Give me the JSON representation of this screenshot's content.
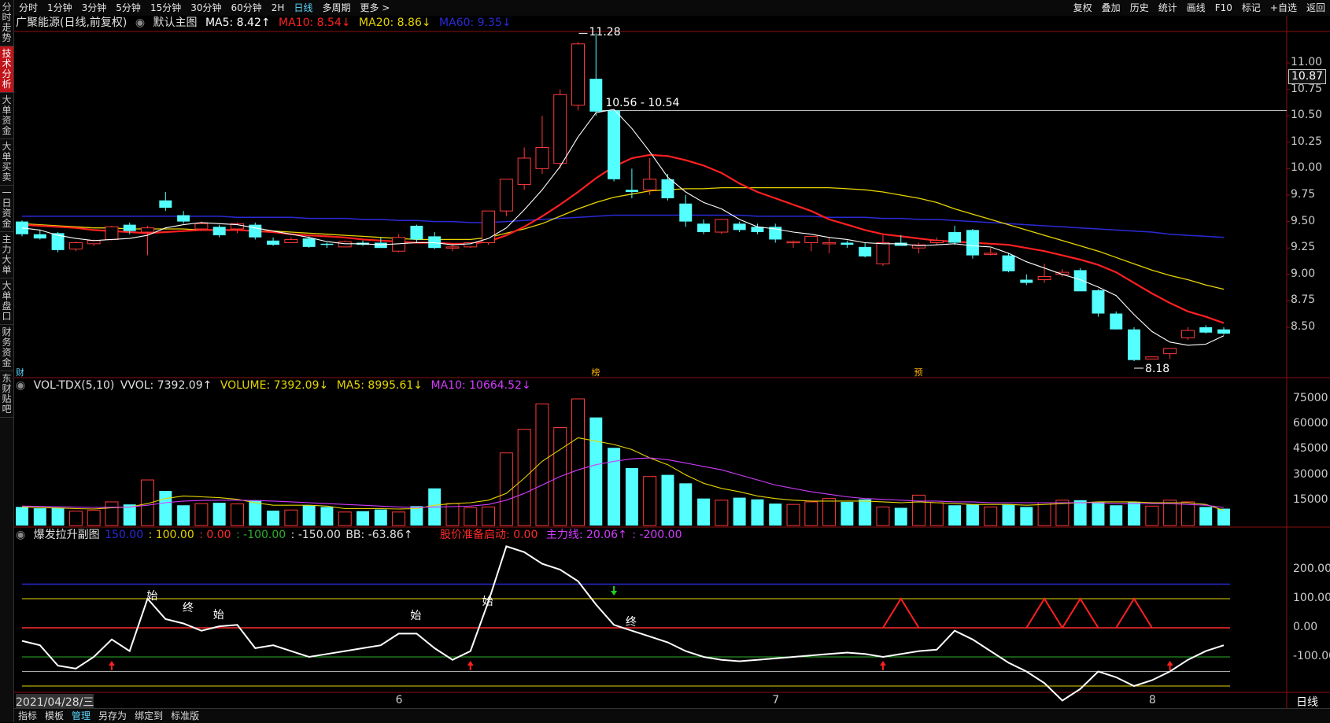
{
  "sidebar": {
    "tabs": [
      {
        "label": "分时走势",
        "active": false
      },
      {
        "label": "技术分析",
        "active": true
      },
      {
        "label": "大单资金",
        "active": false
      },
      {
        "label": "大单买卖",
        "active": false
      },
      {
        "label": "一日资金",
        "active": false
      },
      {
        "label": "主力大单",
        "active": false
      },
      {
        "label": "大单盘口",
        "active": false
      },
      {
        "label": "财务资金",
        "active": false
      },
      {
        "label": "东财贴吧",
        "active": false
      }
    ]
  },
  "toolbar": {
    "periods": [
      "分时",
      "1分钟",
      "3分钟",
      "5分钟",
      "15分钟",
      "30分钟",
      "60分钟",
      "2H",
      "日线",
      "多周期",
      "更多 >"
    ],
    "selected_period": "日线",
    "right": [
      "复权",
      "叠加",
      "历史",
      "统计",
      "画线",
      "F10",
      "标记",
      "+自选",
      "返回"
    ]
  },
  "main_chart": {
    "stock_title": "广聚能源(日线,前复权)",
    "template": "默认主图",
    "ma5": "MA5: 8.42↑",
    "ma10": "MA10: 8.54↓",
    "ma20": "MA20: 8.86↓",
    "ma60": "MA60: 9.35↓",
    "high_label": "11.28",
    "range_label": "10.56 - 10.54",
    "low_label": "8.18",
    "current_price": "10.87",
    "marks": [
      "榜",
      "预"
    ],
    "side_mark": "财",
    "price_ticks": [
      "11.00",
      "10.75",
      "10.50",
      "10.25",
      "10.00",
      "9.75",
      "9.50",
      "9.25",
      "9.00",
      "8.75",
      "8.50"
    ]
  },
  "volume_chart": {
    "title": "VOL-TDX(5,10)",
    "vvol": "VVOL: 7392.09↑",
    "volume": "VOLUME: 7392.09↓",
    "ma5": "MA5: 8995.61↓",
    "ma10": "MA10: 10664.52↓",
    "ticks": [
      "75000",
      "60000",
      "45000",
      "30000",
      "15000"
    ]
  },
  "indicator_chart": {
    "title": "爆发拉升副图",
    "v150": "150.00",
    "v100": ": 100.00",
    "v0": ": 0.00",
    "vm100": ": -100.00",
    "vm150": ": -150.00",
    "bb": "BB: -63.86↑",
    "start_signal": "股价准备启动: 0.00",
    "main_line": "主力线: 20.06↑",
    "m200": ": -200.00",
    "ticks": [
      "200.00",
      "100.00",
      "0.00",
      "-100.00"
    ],
    "signals": [
      "始",
      "终",
      "始",
      "始",
      "始",
      "终"
    ]
  },
  "date_axis": {
    "first": "2021/04/28/三",
    "months": [
      "6",
      "7",
      "8"
    ],
    "period_label": "日线"
  },
  "bottom_bar": {
    "buttons": [
      "指标",
      "模板",
      "管理",
      "另存为",
      "绑定到",
      "标准版"
    ],
    "selected": "管理"
  },
  "colors": {
    "up": "#ff3a3a",
    "down": "#54ffff",
    "ma5": "#ffffff",
    "ma10": "#ff2020",
    "ma20": "#e6d400",
    "ma60": "#2a2ad8",
    "vol_ma10": "#d23cff"
  },
  "candles": [
    [
      9.5,
      9.51,
      9.36,
      9.38
    ],
    [
      9.38,
      9.42,
      9.33,
      9.34
    ],
    [
      9.39,
      9.4,
      9.21,
      9.23
    ],
    [
      9.24,
      9.31,
      9.22,
      9.3
    ],
    [
      9.29,
      9.33,
      9.27,
      9.32
    ],
    [
      9.33,
      9.46,
      9.32,
      9.45
    ],
    [
      9.47,
      9.49,
      9.38,
      9.41
    ],
    [
      9.4,
      9.46,
      9.18,
      9.44
    ],
    [
      9.7,
      9.78,
      9.6,
      9.63
    ],
    [
      9.56,
      9.6,
      9.48,
      9.5
    ],
    [
      9.43,
      9.5,
      9.41,
      9.48
    ],
    [
      9.45,
      9.47,
      9.35,
      9.37
    ],
    [
      9.43,
      9.49,
      9.39,
      9.48
    ],
    [
      9.47,
      9.49,
      9.33,
      9.35
    ],
    [
      9.32,
      9.35,
      9.27,
      9.28
    ],
    [
      9.3,
      9.35,
      9.3,
      9.33
    ],
    [
      9.34,
      9.36,
      9.25,
      9.26
    ],
    [
      9.29,
      9.3,
      9.25,
      9.28
    ],
    [
      9.26,
      9.32,
      9.26,
      9.31
    ],
    [
      9.3,
      9.32,
      9.27,
      9.28
    ],
    [
      9.3,
      9.35,
      9.26,
      9.25
    ],
    [
      9.22,
      9.38,
      9.21,
      9.35
    ],
    [
      9.46,
      9.47,
      9.3,
      9.33
    ],
    [
      9.36,
      9.4,
      9.24,
      9.25
    ],
    [
      9.26,
      9.28,
      9.22,
      9.26
    ],
    [
      9.26,
      9.3,
      9.25,
      9.3
    ],
    [
      9.3,
      9.4,
      9.28,
      9.6
    ],
    [
      9.6,
      9.9,
      9.55,
      9.9
    ],
    [
      9.85,
      10.2,
      9.8,
      10.1
    ],
    [
      10.0,
      10.5,
      9.95,
      10.2
    ],
    [
      10.05,
      10.75,
      10.0,
      10.7
    ],
    [
      10.6,
      11.2,
      10.55,
      11.18
    ],
    [
      10.85,
      11.28,
      10.5,
      10.54
    ],
    [
      10.55,
      10.56,
      9.88,
      9.9
    ],
    [
      9.8,
      10.0,
      9.72,
      9.78
    ],
    [
      9.8,
      10.1,
      9.75,
      9.9
    ],
    [
      9.9,
      9.95,
      9.7,
      9.72
    ],
    [
      9.67,
      9.75,
      9.45,
      9.5
    ],
    [
      9.48,
      9.52,
      9.38,
      9.4
    ],
    [
      9.4,
      9.52,
      9.38,
      9.52
    ],
    [
      9.48,
      9.5,
      9.4,
      9.42
    ],
    [
      9.45,
      9.48,
      9.38,
      9.4
    ],
    [
      9.45,
      9.48,
      9.3,
      9.33
    ],
    [
      9.3,
      9.32,
      9.25,
      9.31
    ],
    [
      9.3,
      9.36,
      9.22,
      9.36
    ],
    [
      9.3,
      9.35,
      9.2,
      9.3
    ],
    [
      9.3,
      9.32,
      9.25,
      9.28
    ],
    [
      9.26,
      9.3,
      9.16,
      9.17
    ],
    [
      9.1,
      9.37,
      9.08,
      9.3
    ],
    [
      9.3,
      9.37,
      9.27,
      9.27
    ],
    [
      9.25,
      9.3,
      9.2,
      9.28
    ],
    [
      9.3,
      9.35,
      9.28,
      9.32
    ],
    [
      9.4,
      9.46,
      9.28,
      9.3
    ],
    [
      9.42,
      9.43,
      9.15,
      9.18
    ],
    [
      9.2,
      9.25,
      9.18,
      9.2
    ],
    [
      9.18,
      9.2,
      9.02,
      9.03
    ],
    [
      8.95,
      9.0,
      8.9,
      8.92
    ],
    [
      8.95,
      9.1,
      8.92,
      8.98
    ],
    [
      9.0,
      9.05,
      8.98,
      9.02
    ],
    [
      9.04,
      9.06,
      8.85,
      8.84
    ],
    [
      8.85,
      8.86,
      8.6,
      8.63
    ],
    [
      8.63,
      8.65,
      8.48,
      8.48
    ],
    [
      8.48,
      8.5,
      8.18,
      8.19
    ],
    [
      8.2,
      8.22,
      8.2,
      8.22
    ],
    [
      8.25,
      8.3,
      8.2,
      8.3
    ],
    [
      8.4,
      8.5,
      8.38,
      8.47
    ],
    [
      8.5,
      8.52,
      8.44,
      8.45
    ],
    [
      8.48,
      8.5,
      8.43,
      8.44
    ]
  ],
  "volumes": [
    11000,
    10200,
    10500,
    8500,
    9000,
    14000,
    12500,
    27000,
    20500,
    12000,
    13000,
    13500,
    12800,
    15000,
    8800,
    9200,
    12000,
    11000,
    8000,
    8500,
    9500,
    8000,
    11500,
    22000,
    13000,
    10500,
    11000,
    43000,
    57000,
    72000,
    58000,
    75000,
    64000,
    46000,
    34000,
    29000,
    30000,
    25000,
    16000,
    15000,
    16500,
    15500,
    13000,
    12500,
    14000,
    16000,
    14000,
    15500,
    11000,
    10500,
    18000,
    13500,
    12000,
    12500,
    11000,
    12500,
    11000,
    13500,
    15000,
    15000,
    14000,
    12000,
    14000,
    11500,
    15000,
    14000,
    11000,
    10000
  ],
  "ma5_line": [
    9.44,
    9.42,
    9.37,
    9.34,
    9.32,
    9.33,
    9.34,
    9.37,
    9.44,
    9.47,
    9.49,
    9.48,
    9.47,
    9.44,
    9.41,
    9.38,
    9.35,
    9.31,
    9.29,
    9.29,
    9.28,
    9.29,
    9.3,
    9.3,
    9.28,
    9.29,
    9.34,
    9.44,
    9.61,
    9.8,
    10.02,
    10.3,
    10.53,
    10.56,
    10.38,
    10.16,
    9.92,
    9.78,
    9.68,
    9.62,
    9.52,
    9.45,
    9.43,
    9.4,
    9.38,
    9.35,
    9.33,
    9.3,
    9.29,
    9.29,
    9.27,
    9.28,
    9.29,
    9.27,
    9.26,
    9.2,
    9.12,
    9.06,
    9.0,
    8.95,
    8.88,
    8.8,
    8.62,
    8.46,
    8.36,
    8.33,
    8.34,
    8.42
  ],
  "ma10_line": [
    9.47,
    9.46,
    9.45,
    9.44,
    9.42,
    9.41,
    9.4,
    9.39,
    9.4,
    9.41,
    9.42,
    9.42,
    9.42,
    9.41,
    9.4,
    9.38,
    9.37,
    9.36,
    9.35,
    9.33,
    9.32,
    9.31,
    9.3,
    9.3,
    9.29,
    9.29,
    9.31,
    9.37,
    9.45,
    9.55,
    9.66,
    9.78,
    9.91,
    10.02,
    10.1,
    10.13,
    10.12,
    10.08,
    10.03,
    9.96,
    9.86,
    9.78,
    9.72,
    9.66,
    9.6,
    9.52,
    9.47,
    9.42,
    9.38,
    9.36,
    9.34,
    9.32,
    9.31,
    9.3,
    9.29,
    9.28,
    9.25,
    9.22,
    9.18,
    9.14,
    9.09,
    9.02,
    8.92,
    8.82,
    8.73,
    8.65,
    8.6,
    8.54
  ],
  "ma20_line": [
    9.48,
    9.47,
    9.46,
    9.45,
    9.44,
    9.44,
    9.43,
    9.43,
    9.43,
    9.43,
    9.42,
    9.42,
    9.42,
    9.41,
    9.41,
    9.4,
    9.39,
    9.38,
    9.37,
    9.36,
    9.35,
    9.34,
    9.33,
    9.33,
    9.33,
    9.33,
    9.35,
    9.39,
    9.43,
    9.48,
    9.55,
    9.62,
    9.68,
    9.73,
    9.76,
    9.79,
    9.8,
    9.81,
    9.81,
    9.82,
    9.82,
    9.82,
    9.82,
    9.82,
    9.82,
    9.82,
    9.81,
    9.8,
    9.78,
    9.75,
    9.72,
    9.68,
    9.62,
    9.57,
    9.52,
    9.47,
    9.42,
    9.37,
    9.32,
    9.27,
    9.22,
    9.16,
    9.1,
    9.04,
    8.99,
    8.95,
    8.9,
    8.86
  ],
  "ma60_line": [
    9.55,
    9.55,
    9.55,
    9.55,
    9.55,
    9.55,
    9.55,
    9.55,
    9.55,
    9.55,
    9.55,
    9.55,
    9.54,
    9.54,
    9.54,
    9.54,
    9.53,
    9.53,
    9.53,
    9.52,
    9.52,
    9.51,
    9.51,
    9.5,
    9.5,
    9.49,
    9.49,
    9.5,
    9.51,
    9.52,
    9.53,
    9.54,
    9.55,
    9.56,
    9.56,
    9.56,
    9.56,
    9.56,
    9.56,
    9.56,
    9.56,
    9.55,
    9.55,
    9.55,
    9.55,
    9.54,
    9.54,
    9.54,
    9.53,
    9.53,
    9.52,
    9.52,
    9.51,
    9.5,
    9.49,
    9.48,
    9.47,
    9.46,
    9.45,
    9.44,
    9.43,
    9.42,
    9.41,
    9.4,
    9.38,
    9.37,
    9.36,
    9.35
  ],
  "vol_ma5": [
    11000,
    10600,
    10400,
    10000,
    9800,
    10500,
    11000,
    13000,
    16000,
    17500,
    17000,
    16500,
    15500,
    13500,
    12000,
    12000,
    12000,
    11500,
    10000,
    10000,
    10000,
    9800,
    10000,
    12000,
    13000,
    13500,
    15000,
    19000,
    28000,
    38000,
    45000,
    52000,
    50000,
    48000,
    45000,
    40000,
    36000,
    30000,
    25000,
    22000,
    20000,
    17500,
    16000,
    15000,
    14500,
    14500,
    14500,
    14500,
    14000,
    13500,
    14000,
    13500,
    13000,
    12500,
    12500,
    12500,
    12000,
    12500,
    13000,
    13500,
    14000,
    14000,
    14000,
    13500,
    13500,
    13500,
    12500,
    9000
  ],
  "vol_ma10": [
    11500,
    11300,
    11100,
    10900,
    10700,
    10800,
    11000,
    12000,
    13500,
    14500,
    14800,
    15000,
    15000,
    14800,
    14500,
    14000,
    13500,
    13000,
    12500,
    12000,
    11500,
    11000,
    10800,
    11000,
    11200,
    11500,
    12500,
    15000,
    19000,
    24000,
    29000,
    33000,
    36000,
    38000,
    39500,
    40000,
    39000,
    37000,
    35000,
    33000,
    30000,
    27000,
    24000,
    22000,
    20000,
    18500,
    17000,
    16000,
    15500,
    15000,
    14500,
    14500,
    14000,
    14000,
    13500,
    13500,
    13500,
    13500,
    13500,
    13500,
    13500,
    13000,
    13000,
    13000,
    13000,
    12500,
    12000,
    10700
  ],
  "bb_line": [
    -45,
    -60,
    -130,
    -140,
    -100,
    -40,
    -80,
    100,
    30,
    15,
    -10,
    5,
    10,
    -70,
    -60,
    -80,
    -100,
    -90,
    -80,
    -70,
    -60,
    -20,
    -20,
    -70,
    -110,
    -80,
    90,
    280,
    260,
    220,
    200,
    160,
    80,
    10,
    -10,
    -30,
    -50,
    -80,
    -100,
    -110,
    -115,
    -110,
    -105,
    -100,
    -95,
    -90,
    -85,
    -90,
    -100,
    -90,
    -80,
    -75,
    -10,
    -40,
    -80,
    -120,
    -150,
    -190,
    -250,
    -210,
    -150,
    -170,
    -200,
    -180,
    -150,
    -110,
    -80,
    -60
  ]
}
